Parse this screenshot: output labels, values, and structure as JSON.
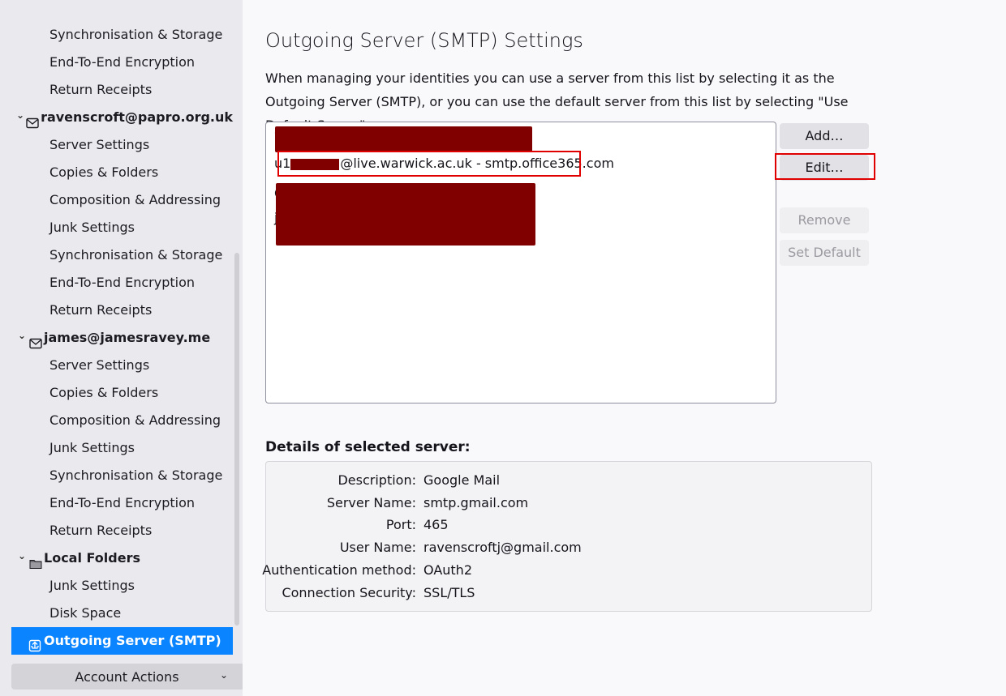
{
  "sidebar": {
    "items": [
      {
        "type": "sub",
        "label": "Synchronisation & Storage"
      },
      {
        "type": "sub",
        "label": "End-To-End Encryption"
      },
      {
        "type": "sub",
        "label": "Return Receipts"
      },
      {
        "type": "account",
        "icon": "mail-icon",
        "label": "ravenscroft@papro.org.uk"
      },
      {
        "type": "sub",
        "label": "Server Settings"
      },
      {
        "type": "sub",
        "label": "Copies & Folders"
      },
      {
        "type": "sub",
        "label": "Composition & Addressing"
      },
      {
        "type": "sub",
        "label": "Junk Settings"
      },
      {
        "type": "sub",
        "label": "Synchronisation & Storage"
      },
      {
        "type": "sub",
        "label": "End-To-End Encryption"
      },
      {
        "type": "sub",
        "label": "Return Receipts"
      },
      {
        "type": "account",
        "icon": "mail-icon",
        "label": "james@jamesravey.me"
      },
      {
        "type": "sub",
        "label": "Server Settings"
      },
      {
        "type": "sub",
        "label": "Copies & Folders"
      },
      {
        "type": "sub",
        "label": "Composition & Addressing"
      },
      {
        "type": "sub",
        "label": "Junk Settings"
      },
      {
        "type": "sub",
        "label": "Synchronisation & Storage"
      },
      {
        "type": "sub",
        "label": "End-To-End Encryption"
      },
      {
        "type": "sub",
        "label": "Return Receipts"
      },
      {
        "type": "account",
        "icon": "folder-icon",
        "label": "Local Folders"
      },
      {
        "type": "sub",
        "label": "Junk Settings"
      },
      {
        "type": "sub",
        "label": "Disk Space"
      },
      {
        "type": "selected",
        "icon": "outgoing-server-icon",
        "label": "Outgoing Server (SMTP)"
      }
    ],
    "account_actions_label": "Account Actions"
  },
  "main": {
    "title": "Outgoing Server (SMTP) Settings",
    "description": "When managing your identities you can use a server from this list by selecting it as the Outgoing Server (SMTP), or you can use the default server from this list by selecting \"Use Default Server\".",
    "servers": [
      {
        "label": "[redacted]",
        "redacted": true
      },
      {
        "label_prefix": "u1",
        "label_suffix": "@live.warwick.ac.uk - smtp.office365.com",
        "redacted": "partial"
      },
      {
        "label": "[redacted]",
        "redacted": true
      },
      {
        "label": "[redacted]",
        "redacted": true
      }
    ],
    "buttons": {
      "add": "Add…",
      "edit": "Edit…",
      "remove": "Remove",
      "set_default": "Set Default"
    },
    "details_heading": "Details of selected server:",
    "details": [
      {
        "label": "Description:",
        "value": "Google Mail"
      },
      {
        "label": "Server Name:",
        "value": "smtp.gmail.com"
      },
      {
        "label": "Port:",
        "value": "465"
      },
      {
        "label": "User Name:",
        "value": "ravenscroftj@gmail.com"
      },
      {
        "label": "Authentication method:",
        "value": "OAuth2"
      },
      {
        "label": "Connection Security:",
        "value": "SSL/TLS"
      }
    ]
  },
  "colors": {
    "selected": "#0a84ff",
    "redaction": "#800000",
    "annotation": "#e00000"
  }
}
